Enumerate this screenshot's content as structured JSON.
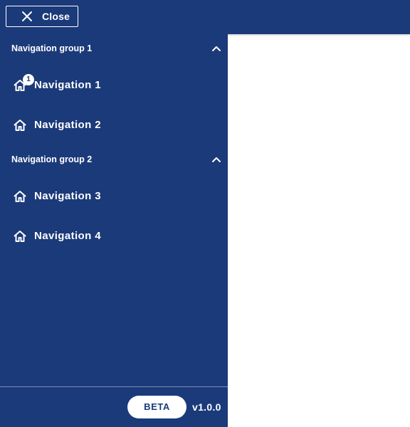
{
  "topbar": {
    "close_label": "Close",
    "close_icon": "close-icon"
  },
  "drawer": {
    "groups": [
      {
        "label": "Navigation group 1",
        "expanded": true,
        "items": [
          {
            "label": "Navigation 1",
            "icon": "home-icon",
            "badge": "1"
          },
          {
            "label": "Navigation 2",
            "icon": "home-icon"
          }
        ]
      },
      {
        "label": "Navigation group 2",
        "expanded": true,
        "items": [
          {
            "label": "Navigation 3",
            "icon": "home-icon"
          },
          {
            "label": "Navigation 4",
            "icon": "home-icon"
          }
        ]
      }
    ],
    "footer": {
      "beta_label": "BETA",
      "version": "v1.0.0"
    }
  },
  "colors": {
    "primary": "#1b3a7a",
    "on_primary": "#ffffff",
    "background": "#ffffff"
  }
}
